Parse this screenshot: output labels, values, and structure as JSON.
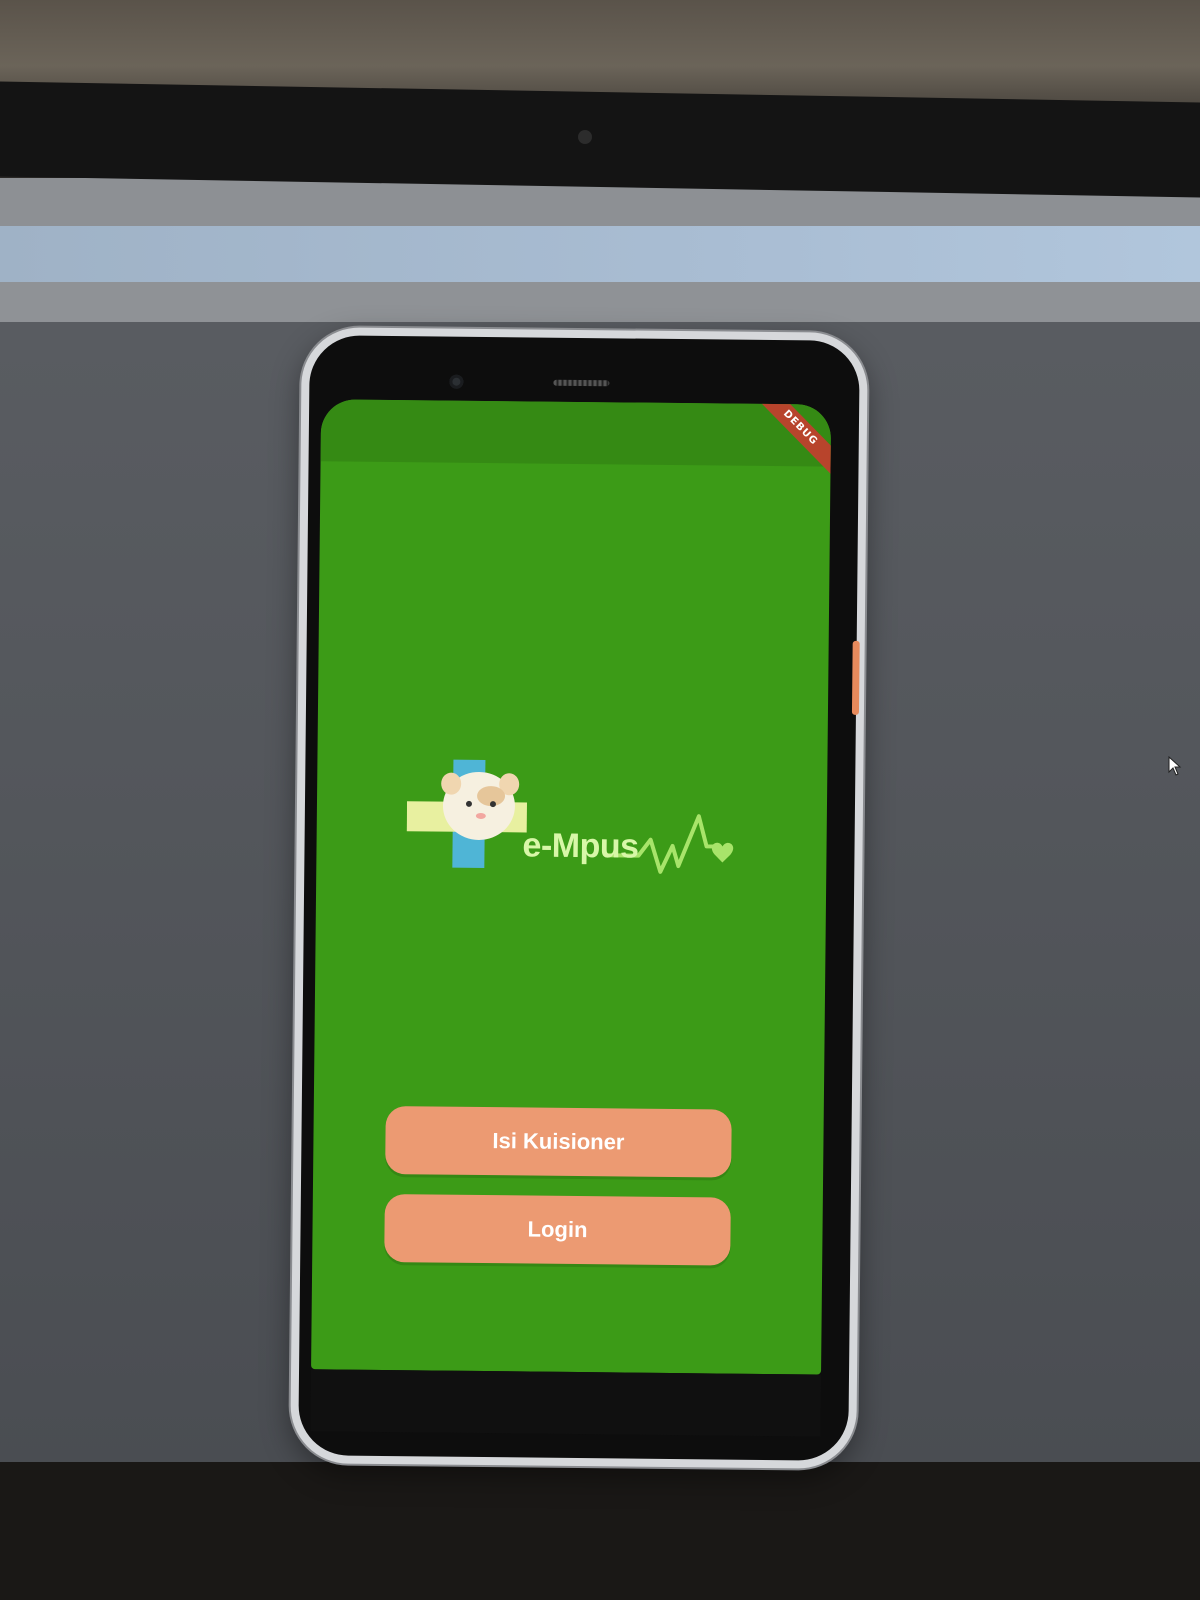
{
  "app": {
    "logo_text": "e-Mpus",
    "debug_banner": "DEBUG"
  },
  "buttons": {
    "kuisioner_label": "Isi Kuisioner",
    "login_label": "Login"
  },
  "colors": {
    "screen_background": "#3c9b17",
    "app_bar": "#358a14",
    "button": "#ec9a72",
    "button_text": "#ffffff",
    "logo_text": "#d8f7a8",
    "heart": "#a8e46a",
    "debug_banner": "#b8442c"
  },
  "icons": {
    "logo_cross": "medical-cross-icon",
    "logo_mascot": "hamster-mascot-icon",
    "logo_pulse": "heartbeat-line-icon",
    "logo_heart": "heart-icon",
    "pointer": "mouse-cursor-icon"
  }
}
